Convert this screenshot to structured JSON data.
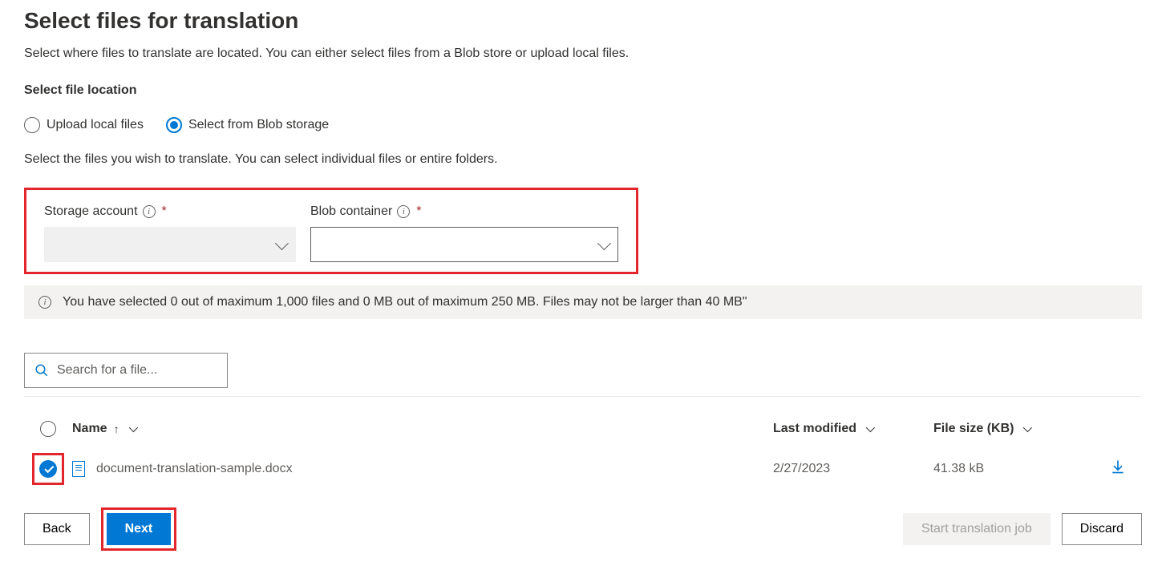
{
  "page": {
    "title": "Select files for translation",
    "description": "Select where files to translate are located. You can either select files from a Blob store or upload local files."
  },
  "location": {
    "label": "Select file location",
    "options": {
      "upload": "Upload local files",
      "blob": "Select from Blob storage"
    },
    "hint": "Select the files you wish to translate. You can select individual files or entire folders."
  },
  "storage": {
    "account_label": "Storage account",
    "container_label": "Blob container"
  },
  "info_bar": "You have selected 0 out of maximum 1,000 files and 0 MB out of maximum 250 MB. Files may not be larger than 40 MB\"",
  "search": {
    "placeholder": "Search for a file..."
  },
  "table": {
    "headers": {
      "name": "Name",
      "modified": "Last modified",
      "size": "File size (KB)"
    },
    "row": {
      "name": "document-translation-sample.docx",
      "modified": "2/27/2023",
      "size": "41.38 kB"
    }
  },
  "footer": {
    "back": "Back",
    "next": "Next",
    "start": "Start translation job",
    "discard": "Discard"
  }
}
